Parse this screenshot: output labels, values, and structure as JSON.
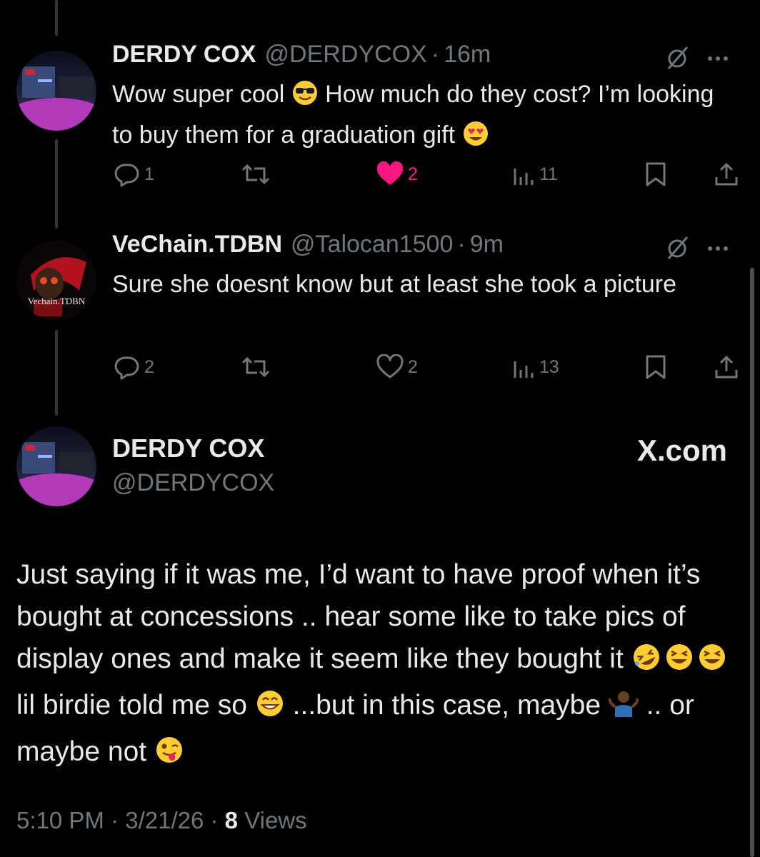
{
  "replies": [
    {
      "name": "DERDY COX",
      "handle": "@DERDYCOX",
      "time": "16m",
      "text_a": "Wow super cool ",
      "text_b": " How much do they cost? I’m looking to buy them for a graduation gift ",
      "emoji_a": "sunglasses-face",
      "emoji_b": "heart-eyes-face",
      "replies": "1",
      "likes": "2",
      "liked": true,
      "views": "11"
    },
    {
      "name": "VeChain.TDBN",
      "handle": "@Talocan1500",
      "time": "9m",
      "text": "Sure she doesnt know but at least she took a picture",
      "replies": "2",
      "likes": "2",
      "liked": false,
      "views": "13",
      "avatar_text": "Vechain.TDBN"
    }
  ],
  "main": {
    "name": "DERDY COX",
    "handle": "@DERDYCOX",
    "site": "X.com",
    "text_1": "Just saying if it was me, I’d want to have proof when it’s bought at concessions .. hear some like to take pics of display ones and make it seem like they bought it ",
    "text_2": "lil birdie told me so ",
    "text_3": " ...but in this case, maybe ",
    "text_4": " .. or maybe not ",
    "time": "5:10 PM",
    "date": "3/21/26",
    "views_count": "8",
    "views_label": "Views"
  },
  "colors": {
    "background": "#000000",
    "text": "#e7e9ea",
    "secondary": "#71767b",
    "like_pink": "#f91880"
  }
}
